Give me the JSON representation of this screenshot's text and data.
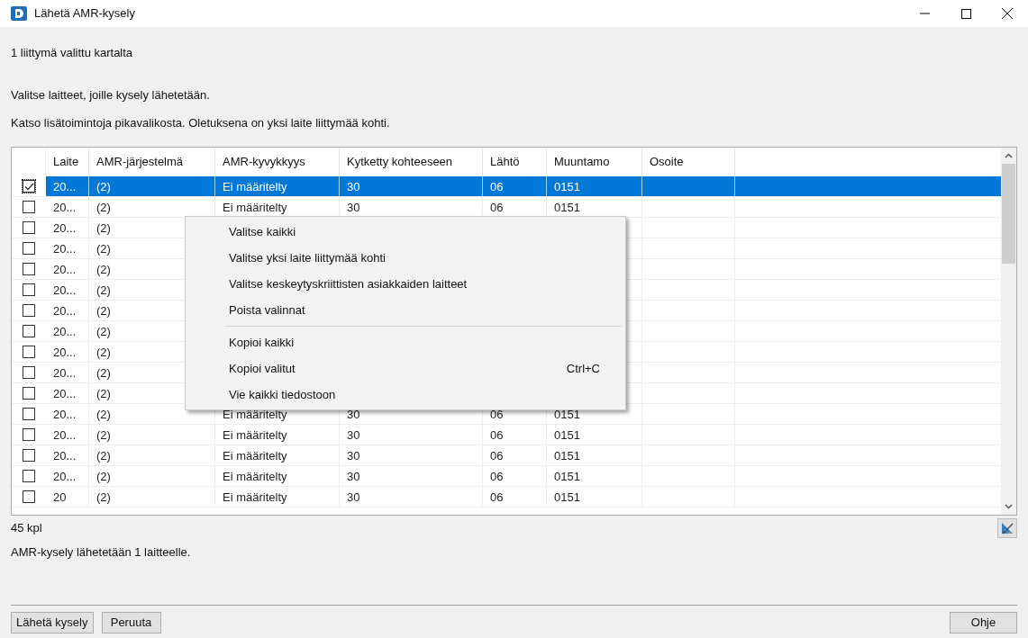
{
  "window": {
    "title": "Lähetä AMR-kysely"
  },
  "selection_info": "1 liittymä valittu kartalta",
  "instructions": [
    "Valitse laitteet, joille kysely lähetetään.",
    "Katso lisätoimintoja pikavalikosta. Oletuksena on yksi laite liittymää kohti."
  ],
  "table": {
    "columns": [
      "Laite",
      "AMR-järjestelmä",
      "AMR-kyvykkyys",
      "Kytketty kohteeseen",
      "Lähtö",
      "Muuntamo",
      "Osoite"
    ],
    "rows": [
      {
        "checked": true,
        "selected": true,
        "cells": [
          "20...",
          "(2)",
          "Ei määritelty",
          "30",
          "06",
          "0151"
        ]
      },
      {
        "checked": false,
        "selected": false,
        "cells": [
          "20...",
          "(2)",
          "Ei määritelty",
          "30",
          "06",
          "0151"
        ]
      },
      {
        "checked": false,
        "selected": false,
        "cells": [
          "20...",
          "(2)"
        ]
      },
      {
        "checked": false,
        "selected": false,
        "cells": [
          "20...",
          "(2)"
        ]
      },
      {
        "checked": false,
        "selected": false,
        "cells": [
          "20...",
          "(2)"
        ]
      },
      {
        "checked": false,
        "selected": false,
        "cells": [
          "20...",
          "(2)"
        ]
      },
      {
        "checked": false,
        "selected": false,
        "cells": [
          "20...",
          "(2)"
        ]
      },
      {
        "checked": false,
        "selected": false,
        "cells": [
          "20...",
          "(2)"
        ]
      },
      {
        "checked": false,
        "selected": false,
        "cells": [
          "20...",
          "(2)"
        ]
      },
      {
        "checked": false,
        "selected": false,
        "cells": [
          "20...",
          "(2)"
        ]
      },
      {
        "checked": false,
        "selected": false,
        "cells": [
          "20...",
          "(2)"
        ]
      },
      {
        "checked": false,
        "selected": false,
        "cells": [
          "20...",
          "(2)",
          "Ei määritelty",
          "30",
          "06",
          "0151"
        ]
      },
      {
        "checked": false,
        "selected": false,
        "cells": [
          "20...",
          "(2)",
          "Ei määritelty",
          "30",
          "06",
          "0151"
        ]
      },
      {
        "checked": false,
        "selected": false,
        "cells": [
          "20...",
          "(2)",
          "Ei määritelty",
          "30",
          "06",
          "0151"
        ]
      },
      {
        "checked": false,
        "selected": false,
        "cells": [
          "20...",
          "(2)",
          "Ei määritelty",
          "30",
          "06",
          "0151"
        ]
      },
      {
        "checked": false,
        "selected": false,
        "cells": [
          "20",
          "(2)",
          "Ei määritelty",
          "30",
          "06",
          "0151"
        ]
      }
    ]
  },
  "context_menu": [
    {
      "kind": "item",
      "label": "Valitse kaikki"
    },
    {
      "kind": "item",
      "label": "Valitse yksi laite liittymää kohti"
    },
    {
      "kind": "item",
      "label": "Valitse keskeytyskriittisten asiakkaiden laitteet"
    },
    {
      "kind": "item",
      "label": "Poista valinnat"
    },
    {
      "kind": "separator"
    },
    {
      "kind": "item",
      "label": "Kopioi kaikki"
    },
    {
      "kind": "item",
      "label": "Kopioi valitut",
      "shortcut": "Ctrl+C"
    },
    {
      "kind": "item",
      "label": "Vie kaikki tiedostoon"
    }
  ],
  "count": "45 kpl",
  "summary": "AMR-kysely lähetetään 1 laitteelle.",
  "buttons": {
    "left": [
      "Lähetä kysely",
      "Peruuta"
    ],
    "right": [
      "Ohje"
    ]
  }
}
